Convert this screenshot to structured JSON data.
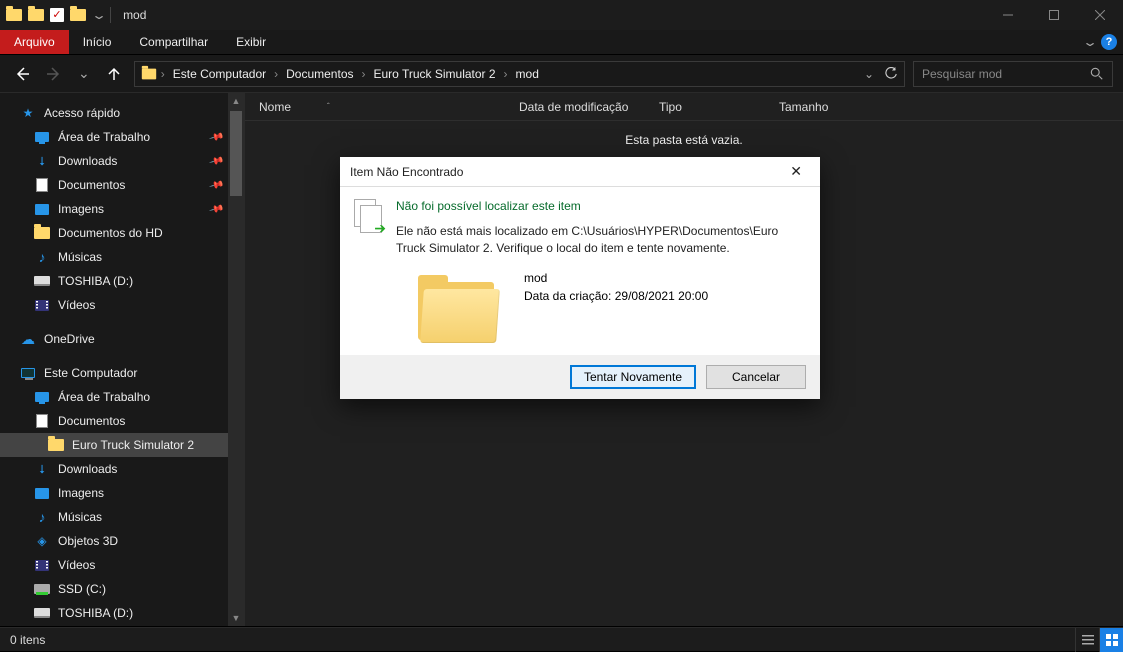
{
  "titlebar": {
    "title": "mod"
  },
  "ribbon": {
    "file": "Arquivo",
    "home": "Início",
    "share": "Compartilhar",
    "view": "Exibir"
  },
  "breadcrumb": {
    "items": [
      "Este Computador",
      "Documentos",
      "Euro Truck Simulator 2",
      "mod"
    ]
  },
  "search": {
    "placeholder": "Pesquisar mod"
  },
  "columns": {
    "name": "Nome",
    "date": "Data de modificação",
    "type": "Tipo",
    "size": "Tamanho"
  },
  "empty": "Esta pasta está vazia.",
  "sidebar": {
    "quick": "Acesso rápido",
    "desktop": "Área de Trabalho",
    "downloads": "Downloads",
    "documents": "Documentos",
    "images": "Imagens",
    "docs_hd": "Documentos do HD",
    "music": "Músicas",
    "toshiba": "TOSHIBA (D:)",
    "videos": "Vídeos",
    "onedrive": "OneDrive",
    "thispc": "Este Computador",
    "desktop2": "Área de Trabalho",
    "documents2": "Documentos",
    "ets2": "Euro Truck Simulator 2",
    "downloads2": "Downloads",
    "images2": "Imagens",
    "music2": "Músicas",
    "objects3d": "Objetos 3D",
    "videos2": "Vídeos",
    "ssd": "SSD (C:)",
    "toshiba2": "TOSHIBA (D:)"
  },
  "dialog": {
    "title": "Item Não Encontrado",
    "headline": "Não foi possível localizar este item",
    "body": "Ele não está mais localizado em C:\\Usuários\\HYPER\\Documentos\\Euro Truck Simulator 2. Verifique o local do item e tente novamente.",
    "item_name": "mod",
    "item_date": "Data da criação: 29/08/2021 20:00",
    "retry": "Tentar Novamente",
    "cancel": "Cancelar"
  },
  "status": {
    "items": "0 itens"
  }
}
